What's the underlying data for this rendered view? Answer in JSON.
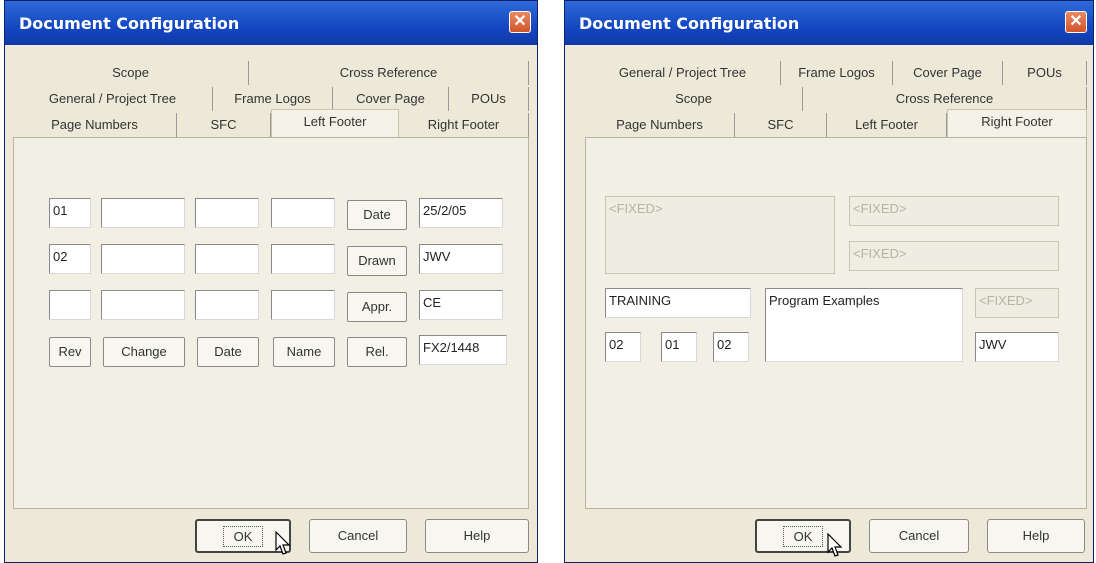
{
  "left": {
    "title": "Document Configuration",
    "close_glyph": "✕",
    "tabs_row1": [
      "Scope",
      "Cross Reference"
    ],
    "tabs_row2": [
      "General / Project Tree",
      "Frame Logos",
      "Cover Page",
      "POUs"
    ],
    "tabs_row3": [
      "Page Numbers",
      "SFC",
      "Left Footer",
      "Right Footer"
    ],
    "active_tab": "Left Footer",
    "rows": [
      {
        "f1": "01",
        "f2": "",
        "f3": "",
        "f4": "",
        "btn": "Date",
        "value": "25/2/05"
      },
      {
        "f1": "02",
        "f2": "",
        "f3": "",
        "f4": "",
        "btn": "Drawn",
        "value": "JWV"
      },
      {
        "f1": "",
        "f2": "",
        "f3": "",
        "f4": "",
        "btn": "Appr.",
        "value": "CE"
      }
    ],
    "header_buttons": [
      "Rev",
      "Change",
      "Date",
      "Name",
      "Rel."
    ],
    "rel_value": "FX2/1448",
    "ok": "OK",
    "cancel": "Cancel",
    "help": "Help"
  },
  "right": {
    "title": "Document Configuration",
    "close_glyph": "✕",
    "tabs_row1": [
      "General / Project Tree",
      "Frame Logos",
      "Cover Page",
      "POUs"
    ],
    "tabs_row2": [
      "Scope",
      "Cross Reference"
    ],
    "tabs_row3": [
      "Page Numbers",
      "SFC",
      "Left Footer",
      "Right Footer"
    ],
    "active_tab": "Right Footer",
    "fixed_text": "<FIXED>",
    "training": "TRAINING",
    "program": "Program Examples",
    "small_fields": [
      "02",
      "01",
      "02"
    ],
    "name_value": "JWV",
    "ok": "OK",
    "cancel": "Cancel",
    "help": "Help"
  },
  "icons": {
    "cursor": "mouse-pointer-icon",
    "close": "close-icon"
  }
}
